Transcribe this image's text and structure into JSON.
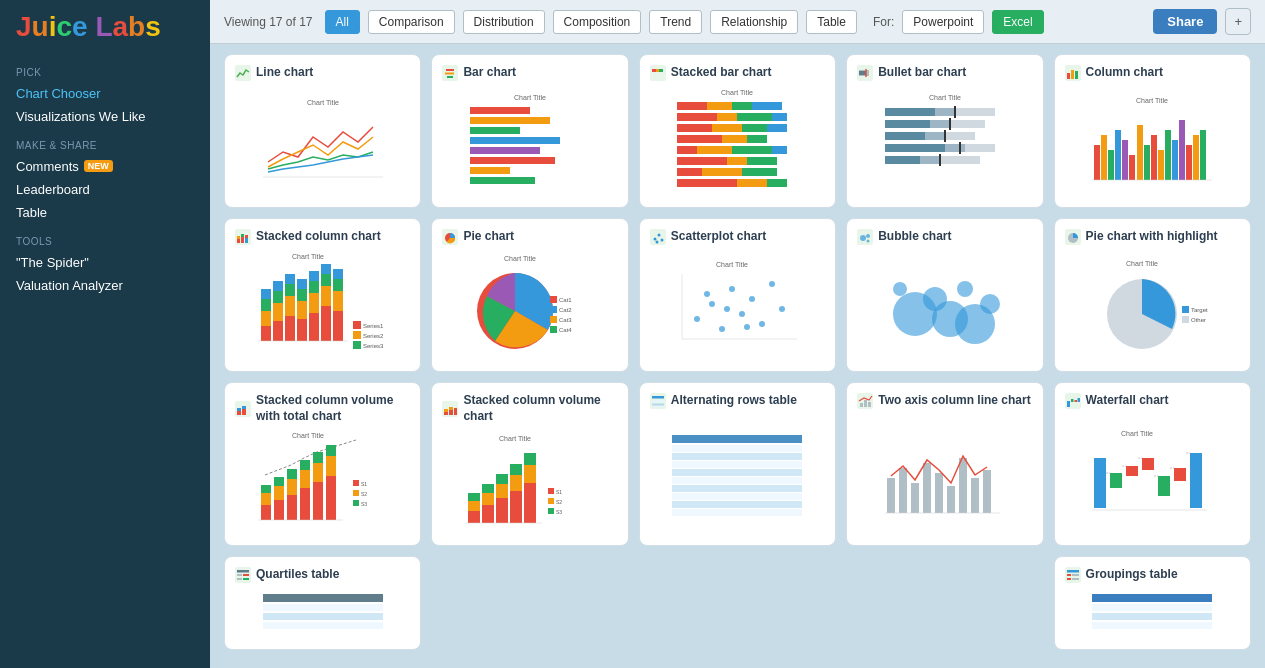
{
  "sidebar": {
    "logo": "Juice Labs",
    "sections": [
      {
        "label": "PICK",
        "items": [
          {
            "id": "chart-chooser",
            "text": "Chart Chooser",
            "active": true
          },
          {
            "id": "visualizations-we-like",
            "text": "Visualizations We Like",
            "active": false
          }
        ]
      },
      {
        "label": "MAKE & SHARE",
        "items": [
          {
            "id": "comments",
            "text": "Comments",
            "active": false,
            "badge": "NEW"
          },
          {
            "id": "leaderboard",
            "text": "Leaderboard",
            "active": false
          },
          {
            "id": "table",
            "text": "Table",
            "active": false
          }
        ]
      },
      {
        "label": "TOOLS",
        "items": [
          {
            "id": "the-spider",
            "text": "\"The Spider\"",
            "active": false
          },
          {
            "id": "valuation-analyzer",
            "text": "Valuation Analyzer",
            "active": false
          }
        ]
      }
    ]
  },
  "topbar": {
    "viewing_text": "Viewing 17 of 17",
    "filters": [
      "All",
      "Comparison",
      "Distribution",
      "Composition",
      "Trend",
      "Relationship",
      "Table"
    ],
    "active_filter": "All",
    "for_label": "For:",
    "for_options": [
      "Powerpoint",
      "Excel"
    ],
    "active_for": "Excel",
    "share_label": "Share",
    "plus_label": "+"
  },
  "charts": [
    {
      "id": "line-chart",
      "title": "Line chart",
      "type": "line"
    },
    {
      "id": "bar-chart",
      "title": "Bar chart",
      "type": "bar"
    },
    {
      "id": "stacked-bar-chart",
      "title": "Stacked bar chart",
      "type": "stacked-bar"
    },
    {
      "id": "bullet-bar-chart",
      "title": "Bullet bar chart",
      "type": "bullet-bar"
    },
    {
      "id": "column-chart",
      "title": "Column chart",
      "type": "column"
    },
    {
      "id": "stacked-column-chart",
      "title": "Stacked column chart",
      "type": "stacked-column"
    },
    {
      "id": "pie-chart",
      "title": "Pie chart",
      "type": "pie"
    },
    {
      "id": "scatterplot-chart",
      "title": "Scatterplot chart",
      "type": "scatter"
    },
    {
      "id": "bubble-chart",
      "title": "Bubble chart",
      "type": "bubble"
    },
    {
      "id": "pie-chart-highlight",
      "title": "Pie chart with highlight",
      "type": "pie-highlight"
    },
    {
      "id": "stacked-column-volume-total",
      "title": "Stacked column volume with total chart",
      "type": "stacked-col-vol-total"
    },
    {
      "id": "stacked-column-volume",
      "title": "Stacked column volume chart",
      "type": "stacked-col-vol"
    },
    {
      "id": "alternating-rows-table",
      "title": "Alternating rows table",
      "type": "table"
    },
    {
      "id": "two-axis-column-line",
      "title": "Two axis column line chart",
      "type": "two-axis"
    },
    {
      "id": "waterfall-chart",
      "title": "Waterfall chart",
      "type": "waterfall"
    },
    {
      "id": "quartiles-table",
      "title": "Quartiles table",
      "type": "quartiles"
    },
    {
      "id": "groupings-table",
      "title": "Groupings table",
      "type": "groupings"
    }
  ]
}
